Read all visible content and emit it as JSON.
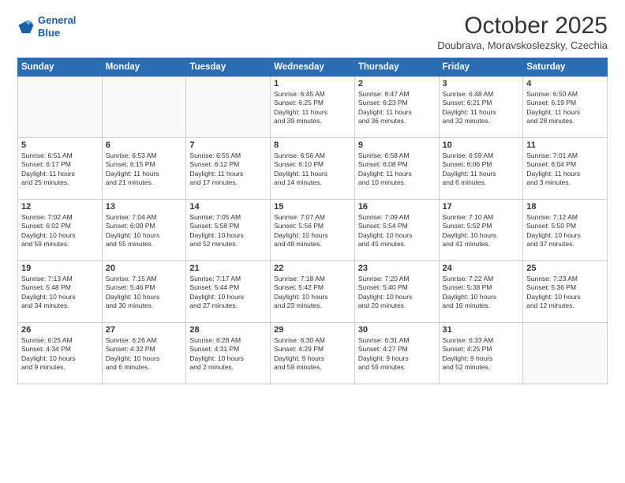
{
  "header": {
    "logo_line1": "General",
    "logo_line2": "Blue",
    "month_title": "October 2025",
    "location": "Doubrava, Moravskoslezsky, Czechia"
  },
  "days_of_week": [
    "Sunday",
    "Monday",
    "Tuesday",
    "Wednesday",
    "Thursday",
    "Friday",
    "Saturday"
  ],
  "weeks": [
    [
      {
        "day": "",
        "info": ""
      },
      {
        "day": "",
        "info": ""
      },
      {
        "day": "",
        "info": ""
      },
      {
        "day": "1",
        "info": "Sunrise: 6:45 AM\nSunset: 6:25 PM\nDaylight: 11 hours\nand 39 minutes."
      },
      {
        "day": "2",
        "info": "Sunrise: 6:47 AM\nSunset: 6:23 PM\nDaylight: 11 hours\nand 36 minutes."
      },
      {
        "day": "3",
        "info": "Sunrise: 6:48 AM\nSunset: 6:21 PM\nDaylight: 11 hours\nand 32 minutes."
      },
      {
        "day": "4",
        "info": "Sunrise: 6:50 AM\nSunset: 6:19 PM\nDaylight: 11 hours\nand 28 minutes."
      }
    ],
    [
      {
        "day": "5",
        "info": "Sunrise: 6:51 AM\nSunset: 6:17 PM\nDaylight: 11 hours\nand 25 minutes."
      },
      {
        "day": "6",
        "info": "Sunrise: 6:53 AM\nSunset: 6:15 PM\nDaylight: 11 hours\nand 21 minutes."
      },
      {
        "day": "7",
        "info": "Sunrise: 6:55 AM\nSunset: 6:12 PM\nDaylight: 11 hours\nand 17 minutes."
      },
      {
        "day": "8",
        "info": "Sunrise: 6:56 AM\nSunset: 6:10 PM\nDaylight: 11 hours\nand 14 minutes."
      },
      {
        "day": "9",
        "info": "Sunrise: 6:58 AM\nSunset: 6:08 PM\nDaylight: 11 hours\nand 10 minutes."
      },
      {
        "day": "10",
        "info": "Sunrise: 6:59 AM\nSunset: 6:06 PM\nDaylight: 11 hours\nand 6 minutes."
      },
      {
        "day": "11",
        "info": "Sunrise: 7:01 AM\nSunset: 6:04 PM\nDaylight: 11 hours\nand 3 minutes."
      }
    ],
    [
      {
        "day": "12",
        "info": "Sunrise: 7:02 AM\nSunset: 6:02 PM\nDaylight: 10 hours\nand 59 minutes."
      },
      {
        "day": "13",
        "info": "Sunrise: 7:04 AM\nSunset: 6:00 PM\nDaylight: 10 hours\nand 55 minutes."
      },
      {
        "day": "14",
        "info": "Sunrise: 7:05 AM\nSunset: 5:58 PM\nDaylight: 10 hours\nand 52 minutes."
      },
      {
        "day": "15",
        "info": "Sunrise: 7:07 AM\nSunset: 5:56 PM\nDaylight: 10 hours\nand 48 minutes."
      },
      {
        "day": "16",
        "info": "Sunrise: 7:09 AM\nSunset: 5:54 PM\nDaylight: 10 hours\nand 45 minutes."
      },
      {
        "day": "17",
        "info": "Sunrise: 7:10 AM\nSunset: 5:52 PM\nDaylight: 10 hours\nand 41 minutes."
      },
      {
        "day": "18",
        "info": "Sunrise: 7:12 AM\nSunset: 5:50 PM\nDaylight: 10 hours\nand 37 minutes."
      }
    ],
    [
      {
        "day": "19",
        "info": "Sunrise: 7:13 AM\nSunset: 5:48 PM\nDaylight: 10 hours\nand 34 minutes."
      },
      {
        "day": "20",
        "info": "Sunrise: 7:15 AM\nSunset: 5:46 PM\nDaylight: 10 hours\nand 30 minutes."
      },
      {
        "day": "21",
        "info": "Sunrise: 7:17 AM\nSunset: 5:44 PM\nDaylight: 10 hours\nand 27 minutes."
      },
      {
        "day": "22",
        "info": "Sunrise: 7:18 AM\nSunset: 5:42 PM\nDaylight: 10 hours\nand 23 minutes."
      },
      {
        "day": "23",
        "info": "Sunrise: 7:20 AM\nSunset: 5:40 PM\nDaylight: 10 hours\nand 20 minutes."
      },
      {
        "day": "24",
        "info": "Sunrise: 7:22 AM\nSunset: 5:38 PM\nDaylight: 10 hours\nand 16 minutes."
      },
      {
        "day": "25",
        "info": "Sunrise: 7:23 AM\nSunset: 5:36 PM\nDaylight: 10 hours\nand 12 minutes."
      }
    ],
    [
      {
        "day": "26",
        "info": "Sunrise: 6:25 AM\nSunset: 4:34 PM\nDaylight: 10 hours\nand 9 minutes."
      },
      {
        "day": "27",
        "info": "Sunrise: 6:26 AM\nSunset: 4:32 PM\nDaylight: 10 hours\nand 6 minutes."
      },
      {
        "day": "28",
        "info": "Sunrise: 6:28 AM\nSunset: 4:31 PM\nDaylight: 10 hours\nand 2 minutes."
      },
      {
        "day": "29",
        "info": "Sunrise: 6:30 AM\nSunset: 4:29 PM\nDaylight: 9 hours\nand 59 minutes."
      },
      {
        "day": "30",
        "info": "Sunrise: 6:31 AM\nSunset: 4:27 PM\nDaylight: 9 hours\nand 55 minutes."
      },
      {
        "day": "31",
        "info": "Sunrise: 6:33 AM\nSunset: 4:25 PM\nDaylight: 9 hours\nand 52 minutes."
      },
      {
        "day": "",
        "info": ""
      }
    ]
  ]
}
